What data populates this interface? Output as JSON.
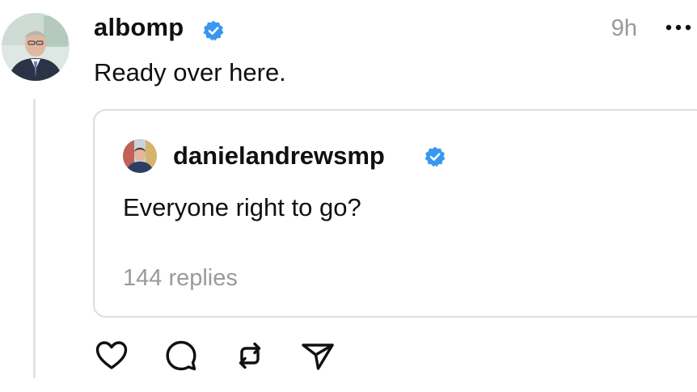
{
  "post": {
    "username": "albomp",
    "timestamp": "9h",
    "text": "Ready over here.",
    "verified": true,
    "avatar_icon": "profile-photo-man-suit",
    "more_icon": "more-dots-icon"
  },
  "quoted_post": {
    "username": "danielandrewsmp",
    "text": "Everyone right to go?",
    "replies": "144 replies",
    "verified": true,
    "avatar_icon": "profile-photo-man-suit"
  },
  "actions": [
    {
      "name": "like",
      "icon": "heart-icon"
    },
    {
      "name": "reply",
      "icon": "comment-icon"
    },
    {
      "name": "repost",
      "icon": "repost-icon"
    },
    {
      "name": "share",
      "icon": "send-icon"
    }
  ],
  "colors": {
    "verified_badge": "#3897f0",
    "muted_text": "#999999",
    "border": "#dddddd",
    "thread_line": "#e2e2e2"
  }
}
